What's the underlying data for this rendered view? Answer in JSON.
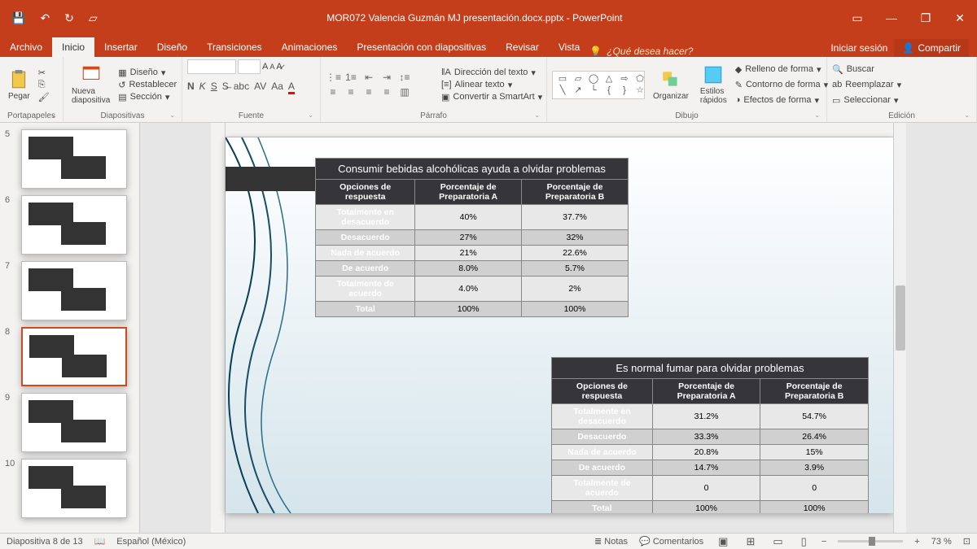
{
  "app": {
    "title": "MOR072 Valencia Guzmán MJ presentación.docx.pptx - PowerPoint"
  },
  "titlebar_icons": [
    "save-icon",
    "undo-icon",
    "redo-icon",
    "start-icon"
  ],
  "window_controls": [
    "ribbon-display-icon",
    "minimize-icon",
    "restore-icon",
    "close-icon"
  ],
  "menu": {
    "file": "Archivo",
    "tabs": [
      "Inicio",
      "Insertar",
      "Diseño",
      "Transiciones",
      "Animaciones",
      "Presentación con diapositivas",
      "Revisar",
      "Vista"
    ],
    "active": "Inicio",
    "tellme_placeholder": "¿Qué desea hacer?",
    "signin": "Iniciar sesión",
    "share": "Compartir"
  },
  "ribbon": {
    "clipboard": {
      "paste": "Pegar",
      "label": "Portapapeles"
    },
    "slides": {
      "new": "Nueva\ndiapositiva",
      "layout": "Diseño",
      "reset": "Restablecer",
      "section": "Sección",
      "label": "Diapositivas"
    },
    "font": {
      "label": "Fuente"
    },
    "paragraph": {
      "textdir": "Dirección del texto",
      "align": "Alinear texto",
      "smartart": "Convertir a SmartArt",
      "label": "Párrafo"
    },
    "drawing": {
      "arrange": "Organizar",
      "quickstyles": "Estilos\nrápidos",
      "fill": "Relleno de forma",
      "outline": "Contorno de forma",
      "effects": "Efectos de forma",
      "label": "Dibujo"
    },
    "editing": {
      "find": "Buscar",
      "replace": "Reemplazar",
      "select": "Seleccionar",
      "label": "Edición"
    }
  },
  "thumbnails": [
    5,
    6,
    7,
    8,
    9,
    10
  ],
  "active_slide": 8,
  "table1": {
    "title": "Consumir bebidas alcohólicas ayuda a olvidar problemas",
    "headers": [
      "Opciones de respuesta",
      "Porcentaje de Preparatoria A",
      "Porcentaje de Preparatoria B"
    ],
    "rows": [
      [
        "Totalmente en desacuerdo",
        "40%",
        "37.7%"
      ],
      [
        "Desacuerdo",
        "27%",
        "32%"
      ],
      [
        "Nada de acuerdo",
        "21%",
        "22.6%"
      ],
      [
        "De acuerdo",
        "8.0%",
        "5.7%"
      ],
      [
        "Totalmente de acuerdo",
        "4.0%",
        "2%"
      ],
      [
        "Total",
        "100%",
        "100%"
      ]
    ]
  },
  "table2": {
    "title": "Es normal fumar para olvidar problemas",
    "headers": [
      "Opciones de respuesta",
      "Porcentaje de Preparatoria A",
      "Porcentaje de Preparatoria B"
    ],
    "rows": [
      [
        "Totalmente en desacuerdo",
        "31.2%",
        "54.7%"
      ],
      [
        "Desacuerdo",
        "33.3%",
        "26.4%"
      ],
      [
        "Nada de acuerdo",
        "20.8%",
        "15%"
      ],
      [
        "De acuerdo",
        "14.7%",
        "3.9%"
      ],
      [
        "Totalmente de acuerdo",
        "0",
        "0"
      ],
      [
        "Total",
        "100%",
        "100%"
      ]
    ]
  },
  "status": {
    "slide": "Diapositiva 8 de 13",
    "lang": "Español (México)",
    "notes": "Notas",
    "comments": "Comentarios",
    "zoom": "73 %"
  }
}
